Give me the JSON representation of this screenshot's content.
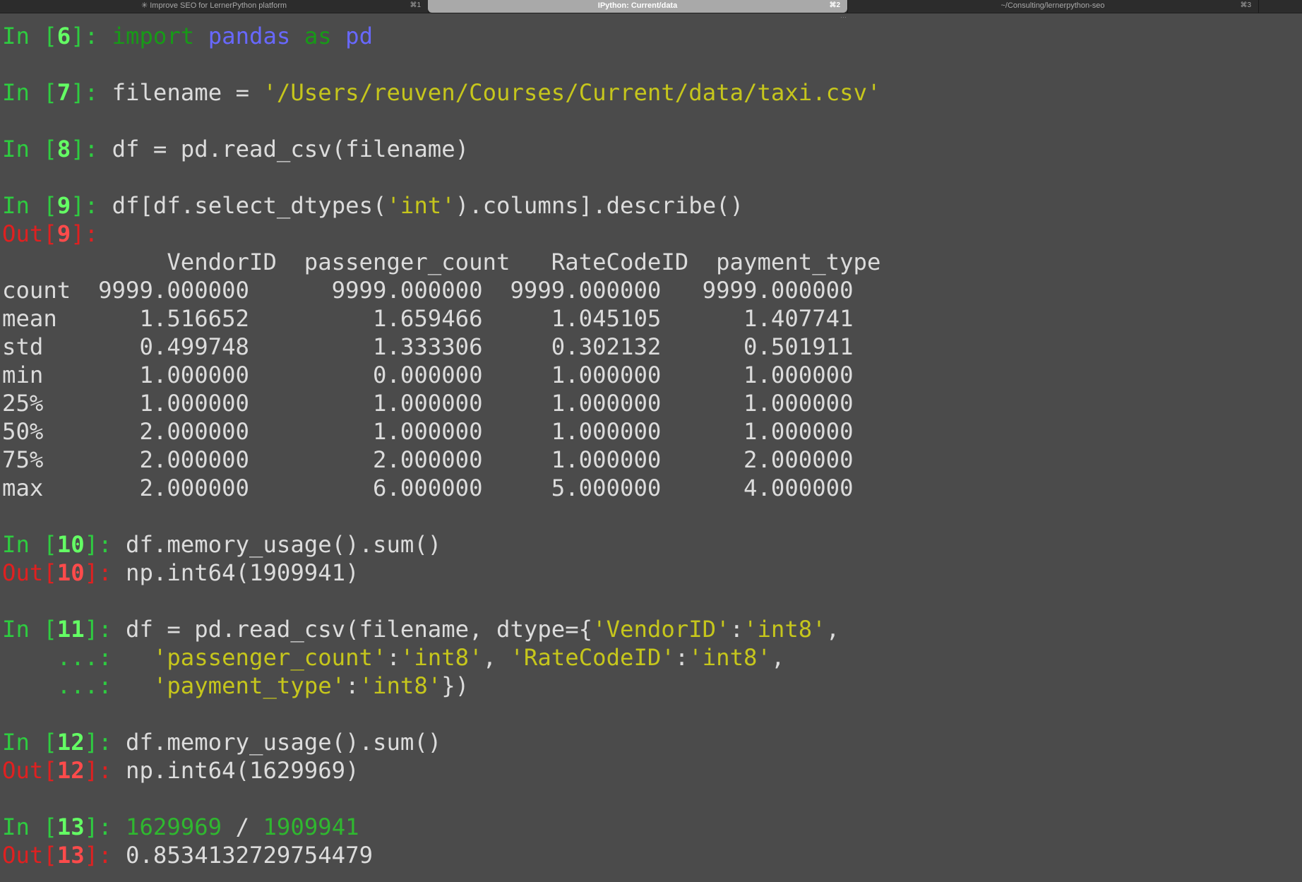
{
  "tabs": [
    {
      "title": "✳ Improve SEO for LernerPython platform",
      "shortcut": "⌘1",
      "active": false
    },
    {
      "title": "IPython: Current/data",
      "shortcut": "⌘2",
      "active": true
    },
    {
      "title": "~/Consulting/lernerpython-seo",
      "shortcut": "⌘3",
      "active": false
    }
  ],
  "tab_overflow": "···",
  "prompts": {
    "in_prefix": "In [",
    "out_prefix": "Out[",
    "suffix": "]: ",
    "continuation": "    ...:   "
  },
  "cells": {
    "c6": {
      "num": "6",
      "kw1": "import",
      "mod1": "pandas",
      "kw2": "as",
      "mod2": "pd"
    },
    "c7": {
      "num": "7",
      "code": "filename = ",
      "str": "'/Users/reuven/Courses/Current/data/taxi.csv'"
    },
    "c8": {
      "num": "8",
      "code": "df = pd.read_csv(filename)"
    },
    "c9": {
      "num": "9",
      "code_a": "df[df.select_dtypes(",
      "str": "'int'",
      "code_b": ").columns].describe()",
      "out_num": "9"
    },
    "c10": {
      "num": "10",
      "code": "df.memory_usage().sum()",
      "out_num": "10",
      "out": "np.int64(1909941)"
    },
    "c11": {
      "num": "11",
      "l1_a": "df = pd.read_csv(filename, dtype={",
      "l1_s1": "'VendorID'",
      "l1_b": ":",
      "l1_s2": "'int8'",
      "l1_c": ",",
      "l2_s1": "'passenger_count'",
      "l2_a": ":",
      "l2_s2": "'int8'",
      "l2_b": ", ",
      "l2_s3": "'RateCodeID'",
      "l2_c": ":",
      "l2_s4": "'int8'",
      "l2_d": ",",
      "l3_s1": "'payment_type'",
      "l3_a": ":",
      "l3_s2": "'int8'",
      "l3_b": "})"
    },
    "c12": {
      "num": "12",
      "code": "df.memory_usage().sum()",
      "out_num": "12",
      "out": "np.int64(1629969)"
    },
    "c13": {
      "num": "13",
      "n1": "1629969",
      "op": " / ",
      "n2": "1909941",
      "out_num": "13",
      "out": "0.8534132729754479"
    }
  },
  "describe_table": {
    "header": "            VendorID  passenger_count   RateCodeID  payment_type",
    "rows": [
      "count  9999.000000      9999.000000  9999.000000   9999.000000",
      "mean      1.516652         1.659466     1.045105      1.407741",
      "std       0.499748         1.333306     0.302132      0.501911",
      "min       1.000000         0.000000     1.000000      1.000000",
      "25%       1.000000         1.000000     1.000000      1.000000",
      "50%       2.000000         1.000000     1.000000      1.000000",
      "75%       2.000000         2.000000     1.000000      2.000000",
      "max       2.000000         6.000000     5.000000      4.000000"
    ]
  },
  "colors": {
    "background": "#4b4b4b",
    "in_prompt": "#2ecc40",
    "out_prompt": "#e02020",
    "keyword": "#179a17",
    "module": "#6868ff",
    "string": "#c6c61c",
    "text": "#dcdcdc"
  }
}
